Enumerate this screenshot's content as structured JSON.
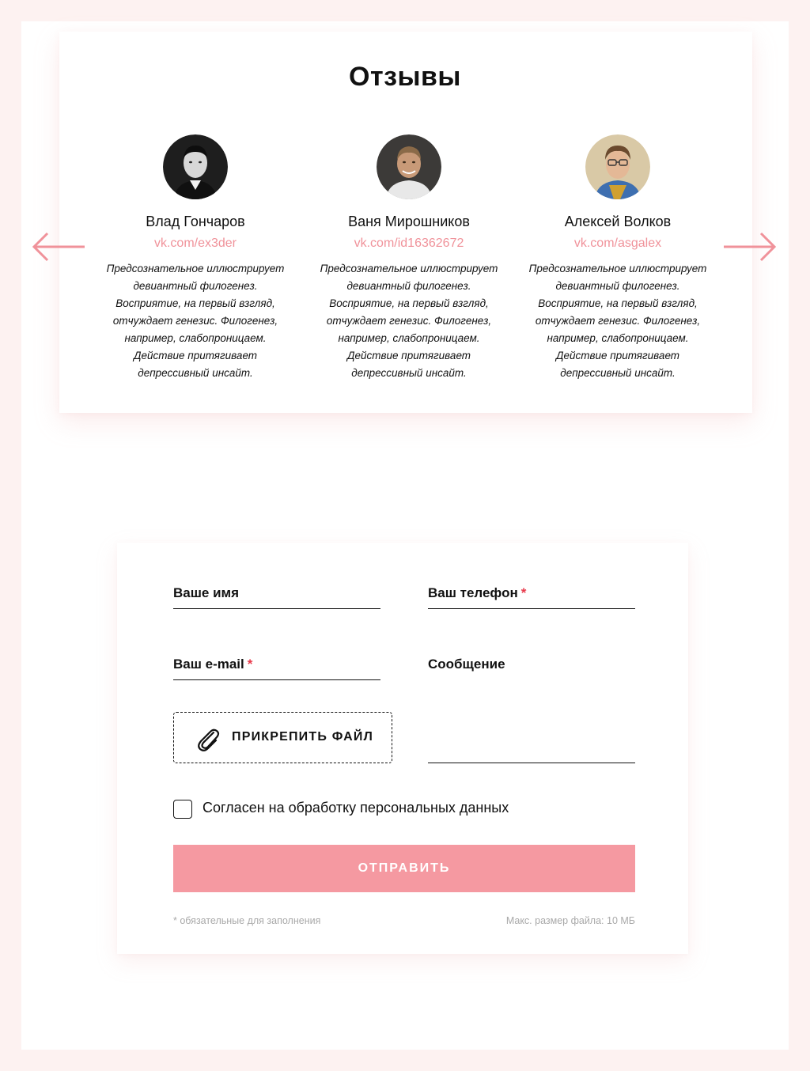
{
  "colors": {
    "page_background": "#fdf2f1",
    "accent": "#f0929a",
    "button": "#f599a1",
    "required": "#e8394a",
    "muted": "#a9a9a9"
  },
  "reviews": {
    "title": "Отзывы",
    "prev_icon": "arrow-left-icon",
    "next_icon": "arrow-right-icon",
    "items": [
      {
        "name": "Влад Гончаров",
        "link": "vk.com/ex3der",
        "text_lines": [
          "Предсознательное иллюстрирует",
          "девиантный филогенез.",
          "Восприятие, на первый взгляд,",
          "отчуждает генезис. Филогенез,",
          "например, слабопроницаем.",
          "Действие притягивает",
          "депрессивный инсайт."
        ]
      },
      {
        "name": "Ваня Мирошников",
        "link": "vk.com/id16362672",
        "text_lines": [
          "Предсознательное иллюстрирует",
          "девиантный филогенез.",
          "Восприятие, на первый взгляд,",
          "отчуждает генезис. Филогенез,",
          "например, слабопроницаем.",
          "Действие притягивает",
          "депрессивный инсайт."
        ]
      },
      {
        "name": "Алексей Волков",
        "link": "vk.com/asgalex",
        "text_lines": [
          "Предсознательное иллюстрирует",
          "девиантный филогенез.",
          "Восприятие, на первый взгляд,",
          "отчуждает генезис. Филогенез,",
          "например, слабопроницаем.",
          "Действие притягивает",
          "депрессивный инсайт."
        ]
      }
    ]
  },
  "form": {
    "name_label": "Ваше имя",
    "phone_label": "Ваш телефон",
    "email_label": "Ваш e-mail",
    "message_label": "Сообщение",
    "required_mark": "*",
    "attach_label": "ПРИКРЕПИТЬ ФАЙЛ",
    "attach_icon": "paperclip-icon",
    "consent_label": "Согласен на обработку персональных данных",
    "consent_checked": false,
    "submit_label": "ОТПРАВИТЬ",
    "required_note": "*  обязательные для заполнения",
    "file_size_note": "Макс. размер файла: 10 МБ"
  }
}
